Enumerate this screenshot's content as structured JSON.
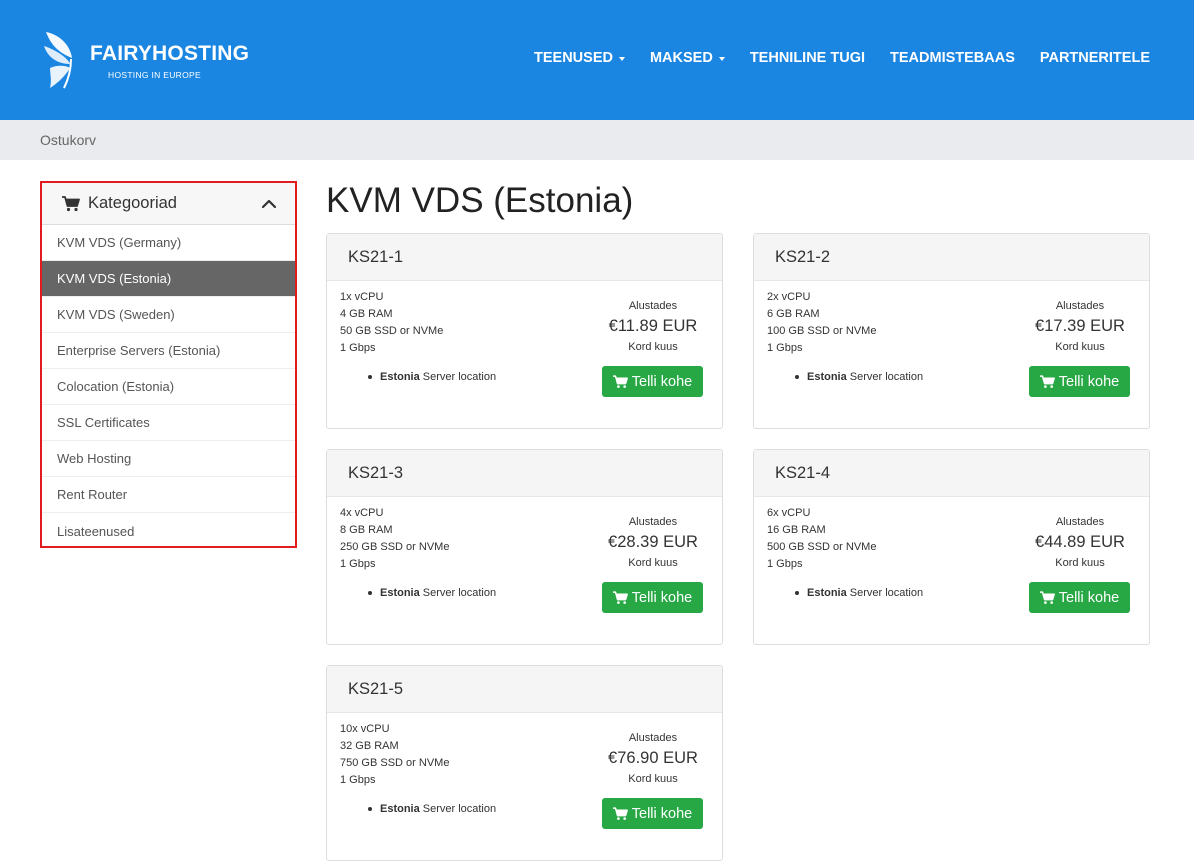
{
  "brand": {
    "name": "FAIRYHOSTING",
    "tagline": "HOSTING IN EUROPE"
  },
  "nav": [
    {
      "label": "TEENUSED",
      "dropdown": true
    },
    {
      "label": "MAKSED",
      "dropdown": true
    },
    {
      "label": "TEHNILINE TUGI",
      "dropdown": false
    },
    {
      "label": "TEADMISTEBAAS",
      "dropdown": false
    },
    {
      "label": "PARTNERITELE",
      "dropdown": false
    }
  ],
  "breadcrumb": "Ostukorv",
  "sidebar": {
    "title": "Kategooriad",
    "items": [
      "KVM VDS (Germany)",
      "KVM VDS (Estonia)",
      "KVM VDS (Sweden)",
      "Enterprise Servers (Estonia)",
      "Colocation (Estonia)",
      "SSL Certificates",
      "Web Hosting",
      "Rent Router",
      "Lisateenused"
    ],
    "active_index": 1
  },
  "page_title": "KVM VDS (Estonia)",
  "price_from_label": "Alustades",
  "price_period_label": "Kord kuus",
  "order_label": "Telli kohe",
  "feature_location": "Estonia",
  "feature_label": "Server location",
  "products": [
    {
      "name": "KS21-1",
      "cpu": "1x vCPU",
      "ram": "4 GB RAM",
      "disk": "50 GB SSD or NVMe",
      "net": "1 Gbps",
      "price": "€11.89 EUR"
    },
    {
      "name": "KS21-2",
      "cpu": "2x vCPU",
      "ram": "6 GB RAM",
      "disk": "100 GB SSD or NVMe",
      "net": "1 Gbps",
      "price": "€17.39 EUR"
    },
    {
      "name": "KS21-3",
      "cpu": "4x vCPU",
      "ram": "8 GB RAM",
      "disk": "250 GB SSD or NVMe",
      "net": "1 Gbps",
      "price": "€28.39 EUR"
    },
    {
      "name": "KS21-4",
      "cpu": "6x vCPU",
      "ram": "16 GB RAM",
      "disk": "500 GB SSD or NVMe",
      "net": "1 Gbps",
      "price": "€44.89 EUR"
    },
    {
      "name": "KS21-5",
      "cpu": "10x vCPU",
      "ram": "32 GB RAM",
      "disk": "750 GB SSD or NVMe",
      "net": "1 Gbps",
      "price": "€76.90 EUR"
    }
  ],
  "colors": {
    "header": "#1b86e2",
    "button": "#28a745",
    "active_item": "#666666",
    "highlight_border": "#e11c1c"
  }
}
